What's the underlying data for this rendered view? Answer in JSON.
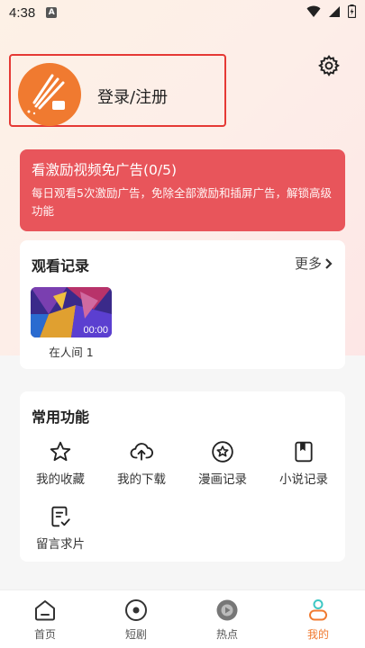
{
  "status_bar": {
    "time": "4:38",
    "notification_icon": "A"
  },
  "header": {
    "login_label": "登录/注册",
    "settings_icon": "gear-icon"
  },
  "ad_banner": {
    "title": "看激励视频免广告(0/5)",
    "description": "每日观看5次激励广告，免除全部激励和插屏广告，解锁高级功能"
  },
  "history": {
    "title": "观看记录",
    "more_label": "更多",
    "items": [
      {
        "title": "在人间 1",
        "duration": "00:00"
      }
    ]
  },
  "functions": {
    "title": "常用功能",
    "items": [
      {
        "label": "我的收藏",
        "icon": "star-icon"
      },
      {
        "label": "我的下载",
        "icon": "cloud-upload-icon"
      },
      {
        "label": "漫画记录",
        "icon": "star-circle-icon"
      },
      {
        "label": "小说记录",
        "icon": "book-icon"
      },
      {
        "label": "留言求片",
        "icon": "note-edit-icon"
      }
    ]
  },
  "tabbar": {
    "tabs": [
      {
        "label": "首页",
        "icon": "home-icon"
      },
      {
        "label": "短剧",
        "icon": "disc-icon"
      },
      {
        "label": "热点",
        "icon": "play-circle-icon"
      },
      {
        "label": "我的",
        "icon": "person-icon",
        "active": true
      }
    ]
  },
  "colors": {
    "accent": "#f07a30",
    "ad_bg": "#e8555b",
    "highlight_border": "#e53935"
  }
}
